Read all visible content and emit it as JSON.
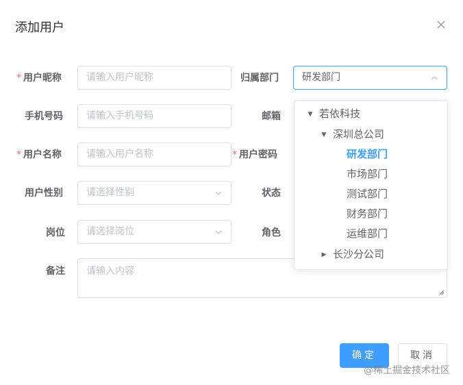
{
  "dialog": {
    "title": "添加用户",
    "close_icon": "close-icon"
  },
  "form": {
    "nickname": {
      "label": "用户昵称",
      "required": "*",
      "placeholder": "请输入用户昵称"
    },
    "dept": {
      "label": "归属部门",
      "value": "研发部门"
    },
    "phone": {
      "label": "手机号码",
      "placeholder": "请输入手机号码"
    },
    "email": {
      "label": "邮箱"
    },
    "username": {
      "label": "用户名称",
      "required": "*",
      "placeholder": "请输入用户名称"
    },
    "password": {
      "label": "用户密码",
      "required": "*"
    },
    "gender": {
      "label": "用户性别",
      "placeholder": "请选择性别"
    },
    "status": {
      "label": "状态"
    },
    "post": {
      "label": "岗位",
      "placeholder": "请选择岗位"
    },
    "role": {
      "label": "角色"
    },
    "remark": {
      "label": "备注",
      "placeholder": "请输入内容"
    }
  },
  "tree": {
    "root": "若依科技",
    "shenzhen": "深圳总公司",
    "children": [
      "研发部门",
      "市场部门",
      "测试部门",
      "财务部门",
      "运维部门"
    ],
    "changsha": "长沙分公司",
    "selected": "研发部门"
  },
  "buttons": {
    "ok": "确定",
    "cancel": "取消"
  },
  "watermark": "@稀土掘金技术社区",
  "colors": {
    "primary": "#409eff",
    "required": "#f56c6c",
    "border": "#dcdfe6",
    "placeholder": "#c0c4cc"
  }
}
